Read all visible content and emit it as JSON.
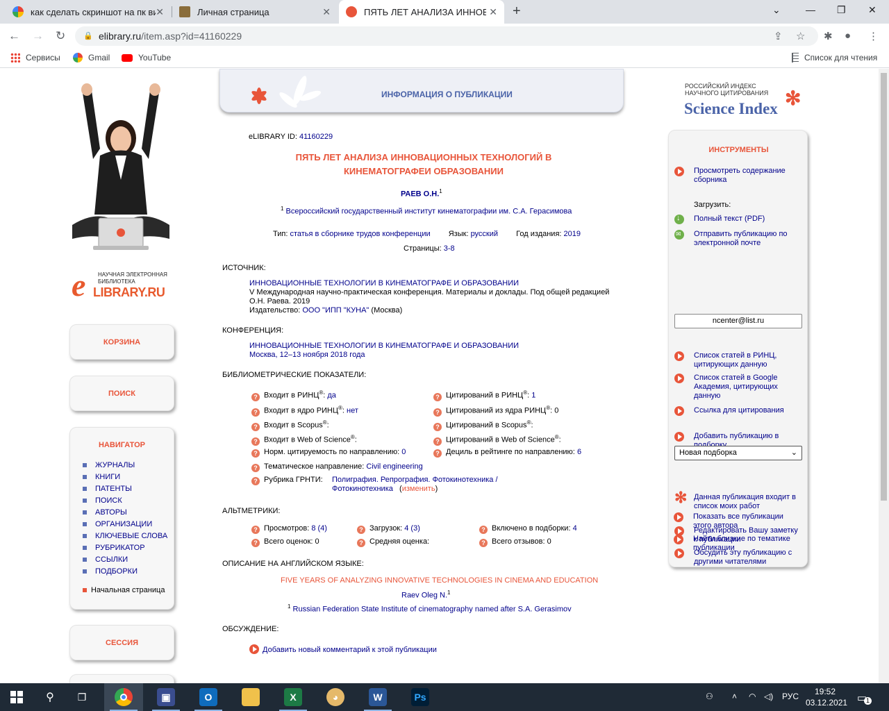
{
  "browser": {
    "tabs": [
      {
        "title": "как сделать скриншот на пк вин",
        "favicon": "google-icon"
      },
      {
        "title": "Личная страница",
        "favicon": "library-icon"
      },
      {
        "title": "ПЯТЬ ЛЕТ АНАЛИЗА ИННОВАЦИ",
        "favicon": "elibrary-icon",
        "active": true
      }
    ],
    "url_host": "elibrary.ru",
    "url_path": "/item.asp?id=41160229",
    "bookmarks": [
      {
        "label": "Сервисы",
        "icon": "apps-grid-icon"
      },
      {
        "label": "Gmail",
        "icon": "google-icon"
      },
      {
        "label": "YouTube",
        "icon": "youtube-icon"
      }
    ],
    "reading_list": "Список для чтения"
  },
  "left": {
    "logo_small": "НАУЧНАЯ ЭЛЕКТРОННАЯ БИБЛИОТЕКА",
    "logo_main": "LIBRARY.RU",
    "logo_e": "e",
    "cart": "КОРЗИНА",
    "search": "ПОИСК",
    "navigator": "НАВИГАТОР",
    "nav_items": [
      "ЖУРНАЛЫ",
      "КНИГИ",
      "ПАТЕНТЫ",
      "ПОИСК",
      "АВТОРЫ",
      "ОРГАНИЗАЦИИ",
      "КЛЮЧЕВЫЕ СЛОВА",
      "РУБРИКАТОР",
      "ССЫЛКИ",
      "ПОДБОРКИ"
    ],
    "home": "Начальная страница",
    "session": "СЕССИЯ"
  },
  "banner": {
    "title": "ИНФОРМАЦИЯ О ПУБЛИКАЦИИ"
  },
  "pub": {
    "id_label": "eLIBRARY ID:",
    "id": "41160229",
    "title1": "ПЯТЬ ЛЕТ АНАЛИЗА ИННОВАЦИОННЫХ ТЕХНОЛОГИЙ В",
    "title2": "КИНЕМАТОГРАФЕИ ОБРАЗОВАНИИ",
    "author": "РАЕВ О.Н.",
    "author_sup": "1",
    "aff_sup": "1",
    "affiliation": "Всероссийский государственный институт кинематографии им. С.А. Герасимова",
    "type_label": "Тип:",
    "type": "статья в сборнике трудов конференции",
    "lang_label": "Язык:",
    "lang": "русский",
    "year_label": "Год издания:",
    "year": "2019",
    "pages_label": "Страницы:",
    "pages": "3-8",
    "source_h": "ИСТОЧНИК:",
    "source_title": "ИННОВАЦИОННЫЕ ТЕХНОЛОГИИ В КИНЕМАТОГРАФЕ И ОБРАЗОВАНИИ",
    "source_desc1": "V Международная научно-практическая конференция. Материалы и доклады. Под общей редакцией",
    "source_desc2": "О.Н. Раева. 2019",
    "publisher_label": "Издательство:",
    "publisher": "ООО \"ИПП \"КУНА\"",
    "publisher_city": "(Москва)",
    "conf_h": "КОНФЕРЕНЦИЯ:",
    "conf_title": "ИННОВАЦИОННЫЕ ТЕХНОЛОГИИ В КИНЕМАТОГРАФЕ И ОБРАЗОВАНИИ",
    "conf_place": "Москва, 12–13 ноября 2018 года",
    "biblio_h": "БИБЛИОМЕТРИЧЕСКИЕ ПОКАЗАТЕЛИ:",
    "m_rinc_label": "Входит в РИНЦ",
    "m_rinc": "да",
    "m_core_label": "Входит в ядро РИНЦ",
    "m_core": "нет",
    "m_scopus_label": "Входит в Scopus",
    "m_wos_label": "Входит в Web of Science",
    "m_norm_label": "Норм. цитируемость по направлению:",
    "m_norm": "0",
    "m_theme_label": "Тематическое направление:",
    "m_theme": "Civil engineering",
    "m_grnti_label": "Рубрика ГРНТИ:",
    "m_grnti1": "Полиграфия. Репрография. Фотокинотехника",
    "m_grnti2": "Фотокинотехника",
    "m_grnti_change": "изменить",
    "c_rinc_label": "Цитирований в РИНЦ",
    "c_rinc": "1",
    "c_core_label": "Цитирований из ядра РИНЦ",
    "c_core": "0",
    "c_scopus_label": "Цитирований в Scopus",
    "c_wos_label": "Цитирований в Web of Science",
    "c_decile_label": "Дециль в рейтинге по направлению:",
    "c_decile": "6",
    "reg": "®",
    "alt_h": "АЛЬТМЕТРИКИ:",
    "views_label": "Просмотров:",
    "views": "8 (4)",
    "downloads_label": "Загрузок:",
    "downloads": "4 (3)",
    "incol_label": "Включено в подборки:",
    "incol": "4",
    "ratings_label": "Всего оценок:",
    "ratings": "0",
    "avg_label": "Средняя оценка:",
    "reviews_label": "Всего отзывов:",
    "reviews": "0",
    "en_h": "ОПИСАНИЕ НА АНГЛИЙСКОМ ЯЗЫКЕ:",
    "en_title": "FIVE YEARS OF ANALYZING INNOVATIVE TECHNOLOGIES IN CINEMA AND EDUCATION",
    "en_author": "Raev Oleg N.",
    "en_aff": "Russian Federation State Institute of cinematography named after S.A. Gerasimov",
    "disc_h": "ОБСУЖДЕНИЕ:",
    "disc_add": "Добавить новый комментарий к этой публикации"
  },
  "right": {
    "logo_l1": "РОССИЙСКИЙ ИНДЕКС",
    "logo_l2": "НАУЧНОГО ЦИТИРОВАНИЯ",
    "logo_l3": "Science Index",
    "tools_h": "ИНСТРУМЕНТЫ",
    "view_contents": "Просмотреть содержание сборника",
    "download_h": "Загрузить:",
    "fulltext": "Полный текст (PDF)",
    "send_email": "Отправить публикацию по электронной почте",
    "email_value": "ncenter@list.ru",
    "list_rinc": "Список статей в РИНЦ, цитирующих данную",
    "list_gs": "Список статей в Google Академия, цитирующих данную",
    "cite_link": "Ссылка для цитирования",
    "add_collection": "Добавить публикацию в подборку",
    "collection_value": "Новая подборка",
    "in_my_works": "Данная публикация входит в список моих работ",
    "edit_note": "Редактировать Вашу заметку к публикации",
    "discuss": "Обсудить эту публикацию с другими читателями",
    "all_author": "Показать все публикации этого автора",
    "similar": "Найти близкие по тематике публикации"
  },
  "taskbar": {
    "lang": "РУС",
    "time": "19:52",
    "date": "03.12.2021",
    "notif_count": "1",
    "apps": [
      "chrome-icon",
      "save-icon",
      "outlook-icon",
      "explorer-icon",
      "excel-icon",
      "paint-icon",
      "word-icon",
      "photoshop-icon"
    ]
  }
}
